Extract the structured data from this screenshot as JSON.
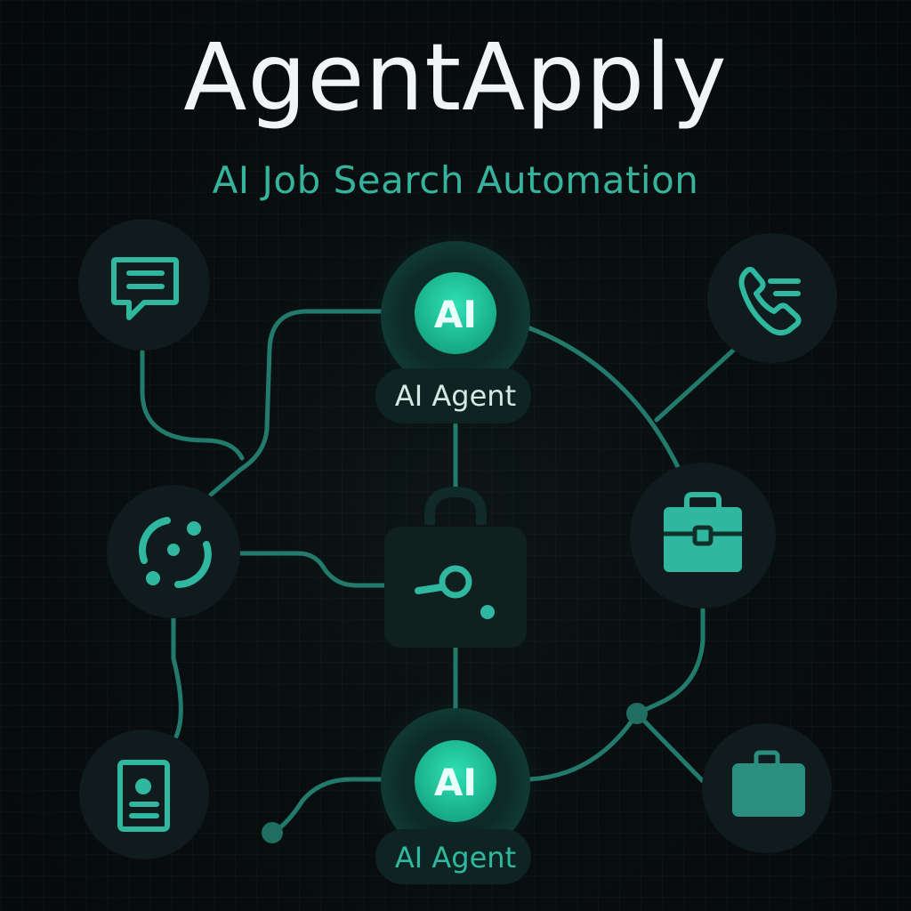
{
  "header": {
    "title": "AgentApply",
    "subtitle": "AI Job Search Automation"
  },
  "nodes": {
    "ai_top": {
      "badge": "AI",
      "label": "AI Agent",
      "icon": "ai-badge-icon"
    },
    "ai_bottom": {
      "badge": "AI",
      "label": "AI Agent",
      "icon": "ai-badge-icon"
    },
    "chat": {
      "icon": "chat-bubble-icon"
    },
    "phone": {
      "icon": "phone-icon"
    },
    "sync": {
      "icon": "sync-circle-icon"
    },
    "briefcase_right": {
      "icon": "briefcase-icon"
    },
    "resume": {
      "icon": "resume-document-icon"
    },
    "briefcase_bottom": {
      "icon": "briefcase-icon"
    },
    "search_lock": {
      "icon": "search-lock-icon"
    }
  },
  "colors": {
    "background": "#070c0d",
    "accent": "#2fb89f",
    "accent_glow": "#1fd0a6",
    "line": "#227a6c",
    "node_fill": "#0f1b1c",
    "title": "#f2f5f5"
  }
}
